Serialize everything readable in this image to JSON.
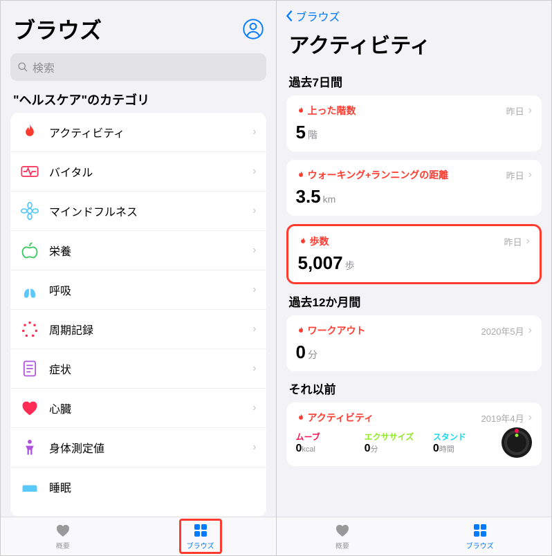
{
  "left": {
    "title": "ブラウズ",
    "search_placeholder": "検索",
    "section": "\"ヘルスケア\"のカテゴリ",
    "rows": {
      "activity": "アクティビティ",
      "vitals": "バイタル",
      "mindfulness": "マインドフルネス",
      "nutrition": "栄養",
      "respiratory": "呼吸",
      "cycle": "周期記録",
      "symptoms": "症状",
      "heart": "心臓",
      "body": "身体測定値",
      "sleep": "睡眠"
    },
    "tabs": {
      "summary": "概要",
      "browse": "ブラウズ"
    }
  },
  "right": {
    "back": "ブラウズ",
    "title": "アクティビティ",
    "s7": "過去7日間",
    "c_floors": {
      "title": "上った階数",
      "date": "昨日",
      "val": "5",
      "unit": "階"
    },
    "c_dist": {
      "title": "ウォーキング+ランニングの距離",
      "date": "昨日",
      "val": "3.5",
      "unit": "km"
    },
    "c_steps": {
      "title": "歩数",
      "date": "昨日",
      "val": "5,007",
      "unit": "歩"
    },
    "s12": "過去12か月間",
    "c_workout": {
      "title": "ワークアウト",
      "date": "2020年5月",
      "val": "0",
      "unit": "分"
    },
    "sprev": "それ以前",
    "c_act": {
      "title": "アクティビティ",
      "date": "2019年4月",
      "move_l": "ムーブ",
      "move_v": "0",
      "move_u": "kcal",
      "ex_l": "エクササイズ",
      "ex_v": "0",
      "ex_u": "分",
      "st_l": "スタンド",
      "st_v": "0",
      "st_u": "時間"
    },
    "tabs": {
      "summary": "概要",
      "browse": "ブラウズ"
    }
  }
}
